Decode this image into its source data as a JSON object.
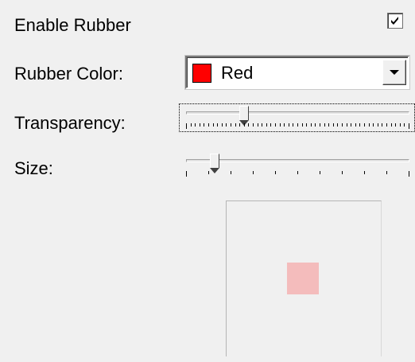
{
  "enable_rubber": {
    "label": "Enable Rubber",
    "checked": true
  },
  "rubber_color": {
    "label": "Rubber Color:",
    "value": "Red",
    "swatch": "#ff0000"
  },
  "transparency": {
    "label": "Transparency:",
    "value_fraction": 0.25,
    "focused": true
  },
  "size": {
    "label": "Size:",
    "value_fraction": 0.11
  },
  "preview": {
    "rubber_color": "#f4bcbc"
  },
  "icons": {
    "dropdown": "chevron-down-icon",
    "check": "checkmark-icon"
  }
}
